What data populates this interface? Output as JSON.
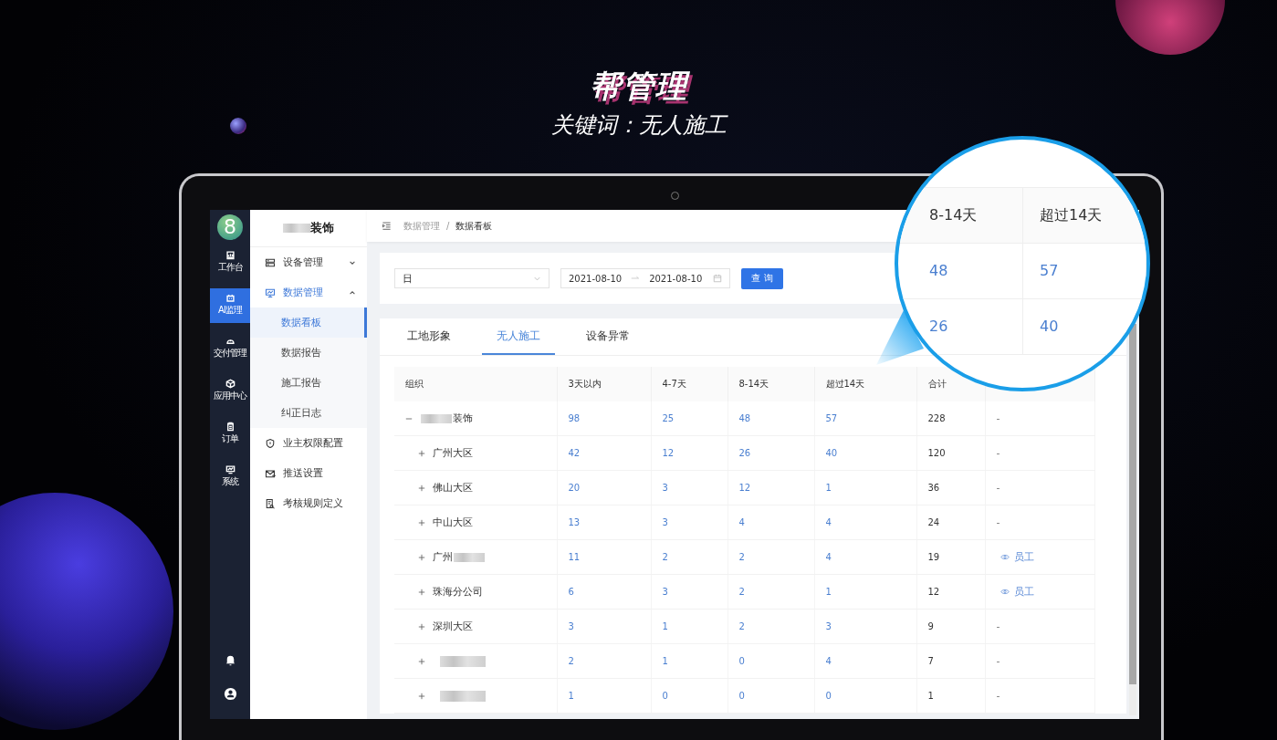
{
  "headline": {
    "title": "帮管理",
    "subtitle": "关键词：无人施工"
  },
  "rail": {
    "logo": "8",
    "items": [
      {
        "label": "工作台",
        "selected": false
      },
      {
        "label": "AI监理",
        "selected": true
      },
      {
        "label": "交付管理",
        "selected": false
      },
      {
        "label": "应用中心",
        "selected": false
      },
      {
        "label": "订单",
        "selected": false
      },
      {
        "label": "系统",
        "selected": false
      }
    ]
  },
  "sidebar": {
    "brand": {
      "name": "装饰",
      "redacted_before": true
    },
    "items": [
      {
        "label": "设备管理",
        "expanded": false,
        "selected": false
      },
      {
        "label": "数据管理",
        "expanded": true,
        "selected": true,
        "children": [
          {
            "label": "数据看板",
            "selected": true
          },
          {
            "label": "数据报告",
            "selected": false
          },
          {
            "label": "施工报告",
            "selected": false
          },
          {
            "label": "纠正日志",
            "selected": false
          }
        ]
      },
      {
        "label": "业主权限配置",
        "selected": false
      },
      {
        "label": "推送设置",
        "selected": false
      },
      {
        "label": "考核规则定义",
        "selected": false
      }
    ]
  },
  "breadcrumb": {
    "items": [
      "数据管理",
      "数据看板"
    ],
    "separator": "/"
  },
  "filter": {
    "period": "日",
    "date_from": "2021-08-10",
    "date_to": "2021-08-10",
    "button": "查 询"
  },
  "tabs": [
    {
      "label": "工地形象",
      "selected": false
    },
    {
      "label": "无人施工",
      "selected": true
    },
    {
      "label": "设备异常",
      "selected": false
    }
  ],
  "table": {
    "columns": [
      {
        "label": "组织",
        "kind": "org"
      },
      {
        "label": "3天以内",
        "kind": "count"
      },
      {
        "label": "4-7天",
        "kind": "count"
      },
      {
        "label": "8-14天",
        "kind": "count"
      },
      {
        "label": "超过14天",
        "kind": "count"
      },
      {
        "label": "合计",
        "kind": "total"
      },
      {
        "kind": "action"
      }
    ],
    "rows": [
      {
        "name": "装饰",
        "redacted_before": true,
        "expanded": true,
        "counts": [
          "98",
          "25",
          "48",
          "57"
        ],
        "total": "228",
        "action": {
          "kind": "dash",
          "text": "-"
        },
        "children": [
          {
            "name": "广州大区",
            "expanded": false,
            "counts": [
              "42",
              "12",
              "26",
              "40"
            ],
            "total": "120",
            "action": {
              "kind": "dash",
              "text": "-"
            }
          },
          {
            "name": "佛山大区",
            "expanded": false,
            "counts": [
              "20",
              "3",
              "12",
              "1"
            ],
            "total": "36",
            "action": {
              "kind": "dash",
              "text": "-"
            }
          },
          {
            "name": "中山大区",
            "expanded": false,
            "counts": [
              "13",
              "3",
              "4",
              "4"
            ],
            "total": "24",
            "action": {
              "kind": "dash",
              "text": "-"
            }
          },
          {
            "name": "广州",
            "redacted_after": true,
            "expanded": false,
            "counts": [
              "11",
              "2",
              "2",
              "4"
            ],
            "total": "19",
            "action": {
              "kind": "link",
              "text": "员工"
            }
          },
          {
            "name": "珠海分公司",
            "expanded": false,
            "counts": [
              "6",
              "3",
              "2",
              "1"
            ],
            "total": "12",
            "action": {
              "kind": "link",
              "text": "员工"
            }
          },
          {
            "name": "深圳大区",
            "expanded": false,
            "counts": [
              "3",
              "1",
              "2",
              "3"
            ],
            "total": "9",
            "action": {
              "kind": "dash",
              "text": "-"
            }
          },
          {
            "redacted_before": true,
            "expanded": false,
            "counts": [
              "2",
              "1",
              "0",
              "4"
            ],
            "total": "7",
            "action": {
              "kind": "dash",
              "text": "-"
            }
          },
          {
            "redacted_before": true,
            "expanded": false,
            "counts": [
              "1",
              "0",
              "0",
              "0"
            ],
            "total": "1",
            "action": {
              "kind": "dash",
              "text": "-"
            }
          }
        ]
      }
    ]
  },
  "magnifier": {
    "columns": [
      "8-14天",
      "超过14天"
    ],
    "rows": [
      [
        "48",
        "57"
      ],
      [
        "26",
        "40"
      ]
    ]
  }
}
